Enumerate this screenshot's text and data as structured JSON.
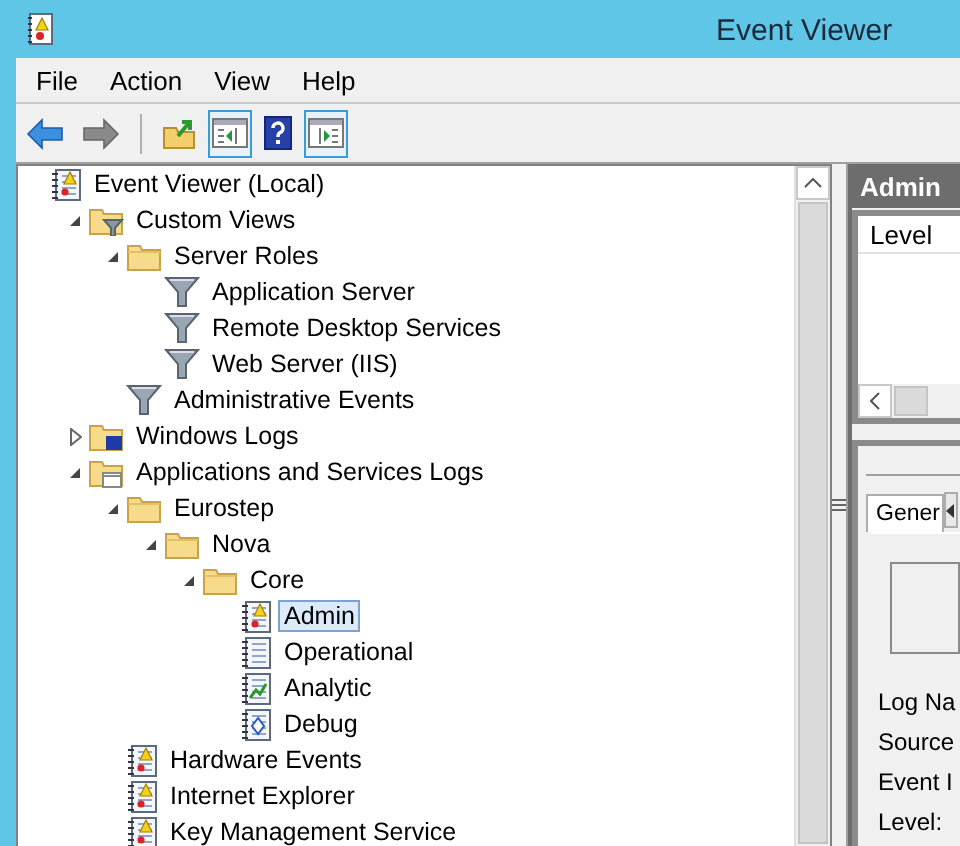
{
  "window": {
    "title": "Event Viewer"
  },
  "menu": [
    "File",
    "Action",
    "View",
    "Help"
  ],
  "toolbar": [
    {
      "kind": "back",
      "disabled": false
    },
    {
      "kind": "forward",
      "disabled": true
    },
    {
      "kind": "separator"
    },
    {
      "kind": "up-folder"
    },
    {
      "kind": "show-tree",
      "pressed": true
    },
    {
      "kind": "help"
    },
    {
      "kind": "show-actions",
      "pressed": true
    }
  ],
  "tree": [
    {
      "label": "Event Viewer (Local)",
      "kind": "event-log",
      "selected": false,
      "children": [
        {
          "label": "Custom Views",
          "kind": "filter-folder",
          "expanded": true,
          "selected": false,
          "children": [
            {
              "label": "Server Roles",
              "kind": "folder",
              "expanded": true,
              "selected": false,
              "children": [
                {
                  "label": "Application Server",
                  "kind": "filter",
                  "selected": false
                },
                {
                  "label": "Remote Desktop Services",
                  "kind": "filter",
                  "selected": false
                },
                {
                  "label": "Web Server (IIS)",
                  "kind": "filter",
                  "selected": false
                }
              ]
            },
            {
              "label": "Administrative Events",
              "kind": "filter",
              "selected": false
            }
          ]
        },
        {
          "label": "Windows Logs",
          "kind": "windows-folder",
          "expanded": false,
          "selected": false
        },
        {
          "label": "Applications and Services Logs",
          "kind": "apps-folder",
          "expanded": true,
          "selected": false,
          "children": [
            {
              "label": "Eurostep",
              "kind": "folder",
              "expanded": true,
              "selected": false,
              "children": [
                {
                  "label": "Nova",
                  "kind": "folder",
                  "expanded": true,
                  "selected": false,
                  "children": [
                    {
                      "label": "Core",
                      "kind": "folder",
                      "expanded": true,
                      "selected": false,
                      "children": [
                        {
                          "label": "Admin",
                          "kind": "event-log",
                          "selected": true
                        },
                        {
                          "label": "Operational",
                          "kind": "plain-log",
                          "selected": false
                        },
                        {
                          "label": "Analytic",
                          "kind": "analytic-log",
                          "selected": false
                        },
                        {
                          "label": "Debug",
                          "kind": "debug-log",
                          "selected": false
                        }
                      ]
                    }
                  ]
                }
              ]
            },
            {
              "label": "Hardware Events",
              "kind": "event-log",
              "selected": false
            },
            {
              "label": "Internet Explorer",
              "kind": "event-log",
              "selected": false
            },
            {
              "label": "Key Management Service",
              "kind": "event-log",
              "selected": false
            }
          ]
        }
      ]
    }
  ],
  "detail": {
    "header": "Admin",
    "columns": [
      "Level"
    ],
    "tabs": [
      "Gener"
    ],
    "fields": [
      "Log Na",
      "Source",
      "Event I",
      "Level:"
    ]
  }
}
